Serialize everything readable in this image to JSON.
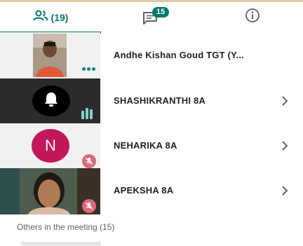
{
  "tabs": {
    "people_count": "(19)",
    "chat_badge": "15"
  },
  "participants": [
    {
      "name": "Andhe Kishan Goud TGT (Y..."
    },
    {
      "name": "SHASHIKRANTHI 8A"
    },
    {
      "name": "NEHARIKA 8A",
      "initial": "N"
    },
    {
      "name": "APEKSHA 8A"
    }
  ],
  "others_label": "Others in the meeting (15)",
  "colors": {
    "accent": "#00796b",
    "avatar_n": "#c2185b",
    "mute_badge": "#d96a7a"
  }
}
